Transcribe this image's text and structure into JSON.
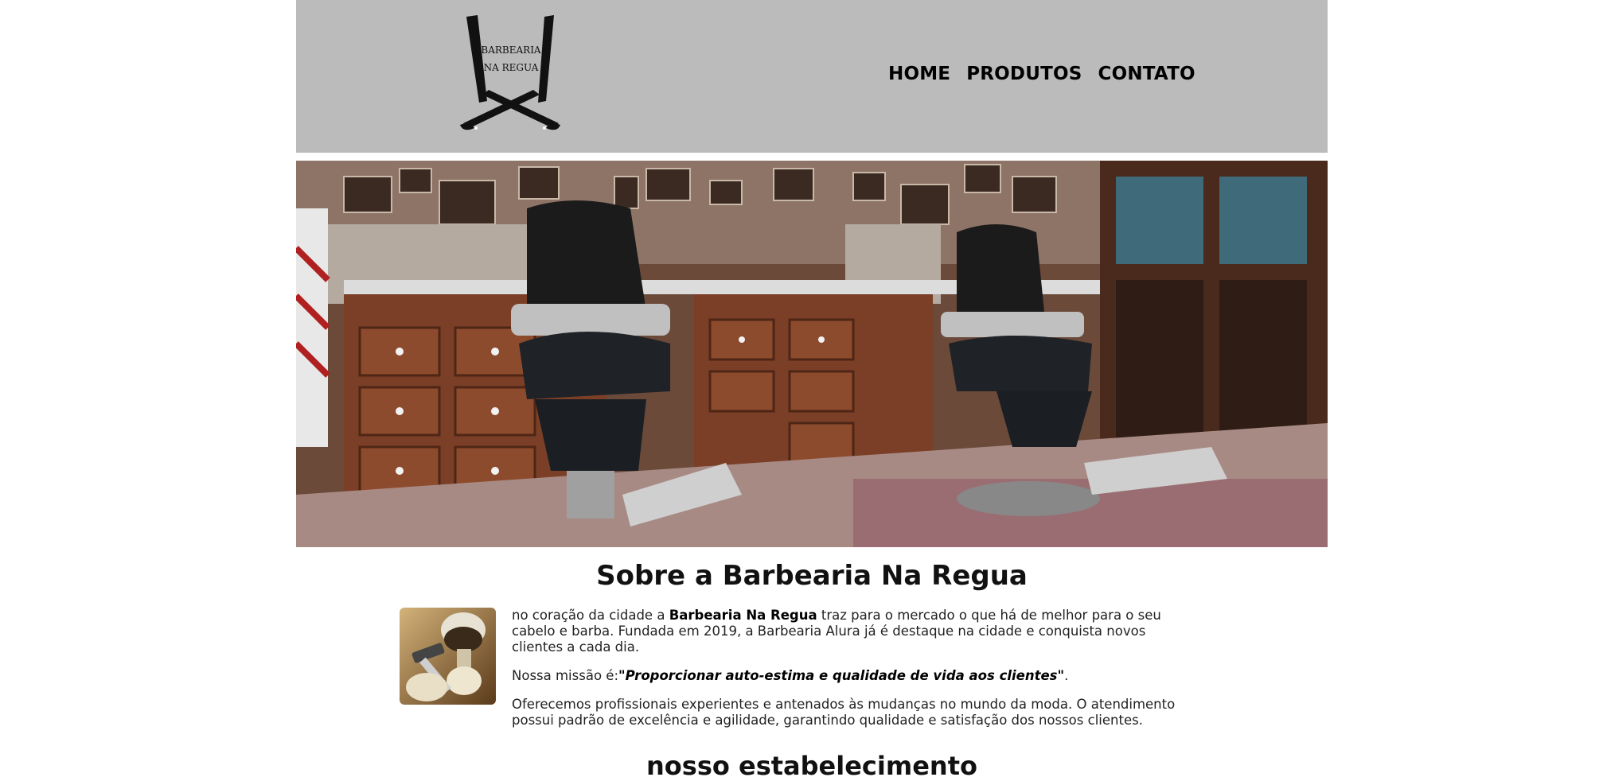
{
  "header": {
    "logo": {
      "line1": "BARBEARIA",
      "line2": "NA REGUA"
    },
    "nav": [
      {
        "label": "HOME"
      },
      {
        "label": "PRODUTOS"
      },
      {
        "label": "CONTATO"
      }
    ],
    "background_color": "#bbbbbb"
  },
  "hero": {
    "icon": "barbershop-interior-photo"
  },
  "about": {
    "title": "Sobre a Barbearia Na Regua",
    "thumbnail_icon": "shaving-brush-razor-photo",
    "p1_prefix": "no coração da cidade a ",
    "p1_brand": "Barbearia Na Regua",
    "p1_suffix": " traz para o mercado o que há de melhor para o seu cabelo e barba. Fundada em 2019, a Barbearia Alura já é destaque na cidade e conquista novos clientes a cada dia.",
    "p2_prefix": "Nossa missão é:",
    "p2_mission": "\"Proporcionar auto-estima e qualidade de vida aos clientes\"",
    "p2_suffix": ".",
    "p3": "Oferecemos profissionais experientes e antenados às mudanças no mundo da moda. O atendimento possui padrão de excelência e agilidade, garantindo qualidade e satisfação dos nossos clientes."
  },
  "establishment": {
    "title": "nosso estabelecimento"
  }
}
